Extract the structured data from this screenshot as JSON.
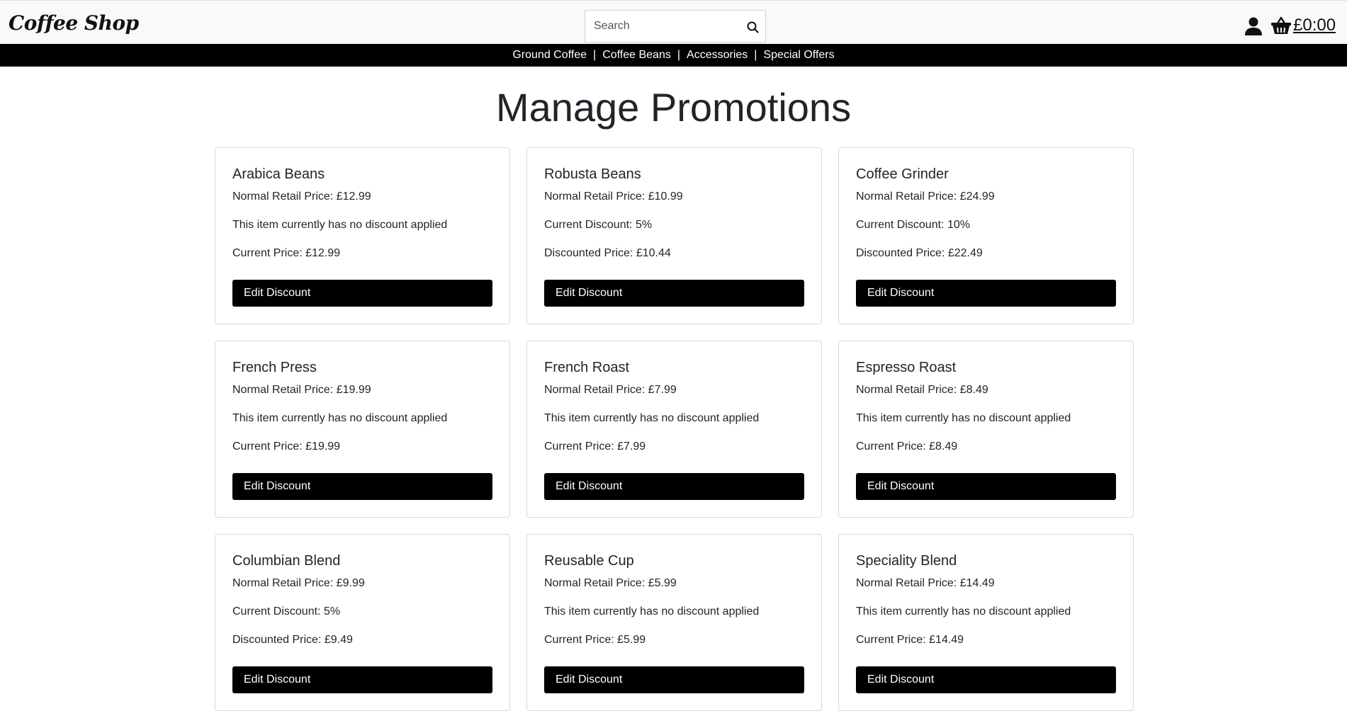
{
  "header": {
    "brand": "Coffee Shop",
    "search_placeholder": "Search",
    "cart_total": "£0:00"
  },
  "category_nav": {
    "items": [
      "Ground Coffee",
      "Coffee Beans",
      "Accessories",
      "Special Offers"
    ],
    "separator": "|"
  },
  "page": {
    "title": "Manage Promotions"
  },
  "products": [
    {
      "name": "Arabica Beans",
      "retail": "Normal Retail Price: £12.99",
      "discount": "This item currently has no discount applied",
      "price": "Current Price: £12.99",
      "button": "Edit Discount"
    },
    {
      "name": "Robusta Beans",
      "retail": "Normal Retail Price: £10.99",
      "discount": "Current Discount: 5%",
      "price": "Discounted Price: £10.44",
      "button": "Edit Discount"
    },
    {
      "name": "Coffee Grinder",
      "retail": "Normal Retail Price: £24.99",
      "discount": "Current Discount: 10%",
      "price": "Discounted Price: £22.49",
      "button": "Edit Discount"
    },
    {
      "name": "French Press",
      "retail": "Normal Retail Price: £19.99",
      "discount": "This item currently has no discount applied",
      "price": "Current Price: £19.99",
      "button": "Edit Discount"
    },
    {
      "name": "French Roast",
      "retail": "Normal Retail Price: £7.99",
      "discount": "This item currently has no discount applied",
      "price": "Current Price: £7.99",
      "button": "Edit Discount"
    },
    {
      "name": "Espresso Roast",
      "retail": "Normal Retail Price: £8.49",
      "discount": "This item currently has no discount applied",
      "price": "Current Price: £8.49",
      "button": "Edit Discount"
    },
    {
      "name": "Columbian Blend",
      "retail": "Normal Retail Price: £9.99",
      "discount": "Current Discount: 5%",
      "price": "Discounted Price: £9.49",
      "button": "Edit Discount"
    },
    {
      "name": "Reusable Cup",
      "retail": "Normal Retail Price: £5.99",
      "discount": "This item currently has no discount applied",
      "price": "Current Price: £5.99",
      "button": "Edit Discount"
    },
    {
      "name": "Speciality Blend",
      "retail": "Normal Retail Price: £14.49",
      "discount": "This item currently has no discount applied",
      "price": "Current Price: £14.49",
      "button": "Edit Discount"
    }
  ],
  "icons": {
    "search": "search-icon",
    "account": "user-icon",
    "cart": "basket-icon"
  }
}
